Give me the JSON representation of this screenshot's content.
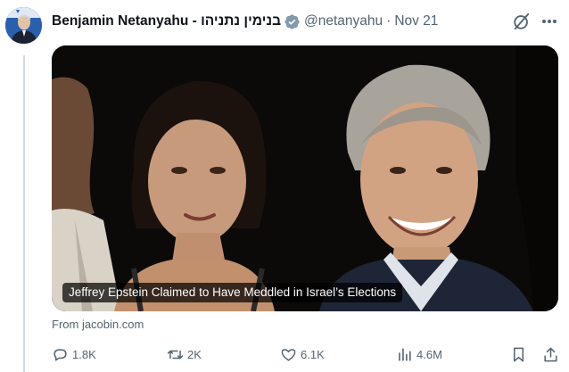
{
  "tweet": {
    "author_name": "Benjamin Netanyahu - בנימין נתניהו",
    "handle": "@netanyahu",
    "separator": "·",
    "date": "Nov 21"
  },
  "media": {
    "caption": "Jeffrey Epstein Claimed to Have Meddled in Israel’s Elections"
  },
  "link": {
    "source": "From jacobin.com"
  },
  "actions": {
    "replies": "1.8K",
    "reposts": "2K",
    "likes": "6.1K",
    "views": "4.6M"
  },
  "icons": [
    "grok-icon",
    "more-icon",
    "verified-icon",
    "reply-icon",
    "repost-icon",
    "like-icon",
    "views-icon",
    "bookmark-icon",
    "share-icon"
  ],
  "colors": {
    "text": "#0f1419",
    "secondary": "#536471",
    "verified": "#829aab",
    "thread_line": "#cfd9de"
  }
}
